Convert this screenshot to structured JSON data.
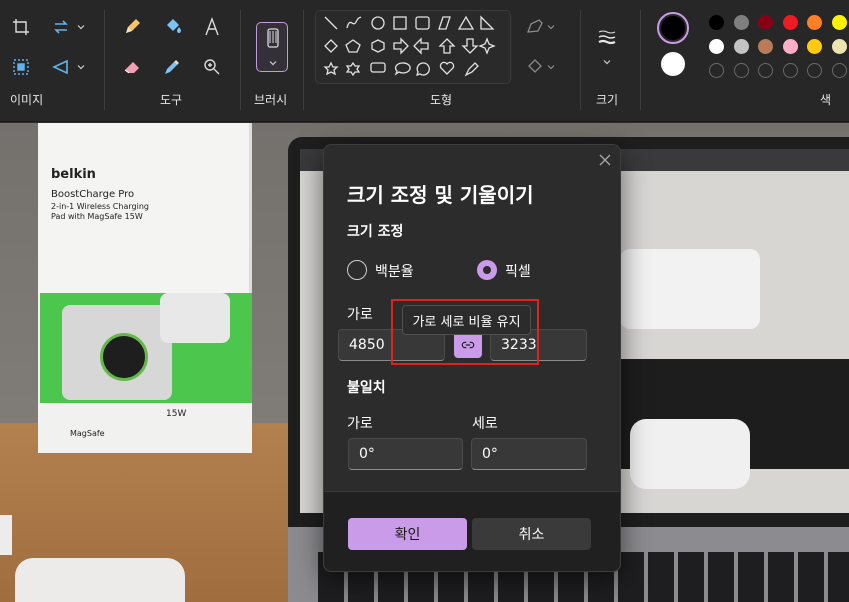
{
  "toolbar": {
    "groups": {
      "image": "이미지",
      "tools": "도구",
      "brush": "브러시",
      "shapes": "도형",
      "size": "크기",
      "color": "색"
    },
    "icons": {
      "image": [
        "crop-icon",
        "rotate-flip-icon",
        "select-icon",
        "flip-icon"
      ],
      "tools": [
        "pencil-icon",
        "fill-bucket-icon",
        "text-icon",
        "eraser-icon",
        "color-picker-icon",
        "magnifier-icon"
      ],
      "size": "line-width-icon"
    },
    "colors": {
      "primary": "#000000",
      "secondary": "#ffffff",
      "palette": [
        "#000000",
        "#7f7f7f",
        "#880015",
        "#ed1c24",
        "#ff7f27",
        "#fff200",
        "#ffffff",
        "#c3c3c3",
        "#b97a57",
        "#ffaec9",
        "#ffc90e",
        "#efe4b0"
      ],
      "empty_slots": 6
    }
  },
  "dialog": {
    "title": "크기 조정 및 기울이기",
    "resize_title": "크기 조정",
    "radio_percent": "백분율",
    "radio_pixel": "픽셀",
    "selected": "픽셀",
    "horizontal_label": "가로",
    "width_value": "4850",
    "height_value": "3233",
    "tooltip": "가로 세로 비율 유지",
    "skew_title": "불일치",
    "skew_h_label": "가로",
    "skew_v_label": "세로",
    "skew_h_value": "0°",
    "skew_v_value": "0°",
    "ok": "확인",
    "cancel": "취소"
  },
  "photo": {
    "box_brand": "belkin",
    "box_product": "BoostCharge Pro",
    "box_subtitle": "2-in-1 Wireless Charging Pad with MagSafe 15W",
    "box_badge": "MagSafe",
    "box_watt": "15W"
  }
}
